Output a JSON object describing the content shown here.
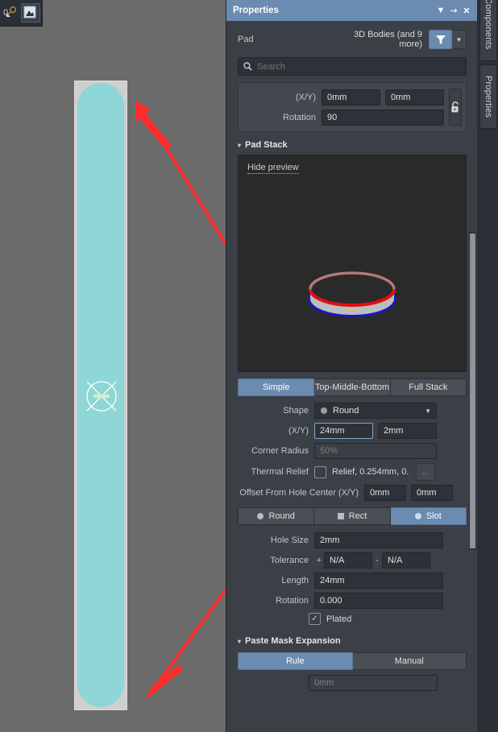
{
  "app": {
    "canvas_bg": "#6b6b6b",
    "panel_bg": "#3b3f46",
    "accent": "#6b8bb0",
    "pad_fill": "#8ed7d6",
    "annotation_color": "#ff2d2d"
  },
  "toolbar": {
    "icon1": "zoom-icon",
    "icon2": "image-icon"
  },
  "canvas": {
    "pad_name": "slot-pad",
    "center_marker": "origin-cross-marker"
  },
  "panel": {
    "title": "Properties",
    "header_buttons": [
      {
        "name": "dropdown-menu-icon",
        "glyph": "▼"
      },
      {
        "name": "pin-icon",
        "glyph": "⤑"
      },
      {
        "name": "close-icon",
        "glyph": "✕"
      }
    ],
    "object": {
      "kind": "Pad",
      "description": "3D Bodies (and 9 more)",
      "filter_icon": "funnel-icon",
      "filter_arrow_icon": "chevron-down-icon"
    },
    "search": {
      "placeholder": "Search",
      "value": "",
      "icon": "search-icon"
    },
    "location": {
      "xy_label": "(X/Y)",
      "x_value": "0mm",
      "y_value": "0mm",
      "rotation_label": "Rotation",
      "rotation_value": "90",
      "lock_icon": "unlocked-padlock-icon"
    },
    "pad_stack": {
      "section_title": "Pad Stack",
      "hide_preview_label": "Hide preview",
      "preview_object": "3d-ring-pad-preview",
      "preview_colors": {
        "top": "#e01010",
        "bottom": "#1414dc",
        "body": "#c8c8c8"
      },
      "stack_modes": [
        {
          "label": "Simple",
          "selected": true
        },
        {
          "label": "Top-Middle-Bottom",
          "selected": false
        },
        {
          "label": "Full Stack",
          "selected": false
        }
      ],
      "shape_label": "Shape",
      "shape_value": "Round",
      "size_label": "(X/Y)",
      "size_x": "24mm",
      "size_y": "2mm",
      "corner_radius_label": "Corner Radius",
      "corner_radius_value": "50%",
      "thermal_relief_label": "Thermal Relief",
      "thermal_relief_checked": false,
      "thermal_relief_value": "Relief, 0.254mm, 0.",
      "thermal_relief_more": "...",
      "offset_label": "Offset From Hole Center (X/Y)",
      "offset_x": "0mm",
      "offset_y": "0mm",
      "hole_shapes": [
        {
          "label": "Round",
          "selected": false,
          "marker": "circle"
        },
        {
          "label": "Rect",
          "selected": false,
          "marker": "square"
        },
        {
          "label": "Slot",
          "selected": true,
          "marker": "circle"
        }
      ],
      "hole_size_label": "Hole Size",
      "hole_size_value": "2mm",
      "tolerance_label": "Tolerance",
      "tolerance_plus_sign": "+",
      "tolerance_plus_value": "N/A",
      "tolerance_minus_sign": "-",
      "tolerance_minus_value": "N/A",
      "length_label": "Length",
      "length_value": "24mm",
      "hole_rotation_label": "Rotation",
      "hole_rotation_value": "0.000",
      "plated_label": "Plated",
      "plated_checked": true
    },
    "paste_mask": {
      "section_title": "Paste Mask Expansion",
      "modes": [
        {
          "label": "Rule",
          "selected": true
        },
        {
          "label": "Manual",
          "selected": false
        }
      ],
      "value": "0mm"
    }
  },
  "vertical_tabs": [
    {
      "label": "Components",
      "name": "vtab-components"
    },
    {
      "label": "Properties",
      "name": "vtab-properties"
    }
  ]
}
